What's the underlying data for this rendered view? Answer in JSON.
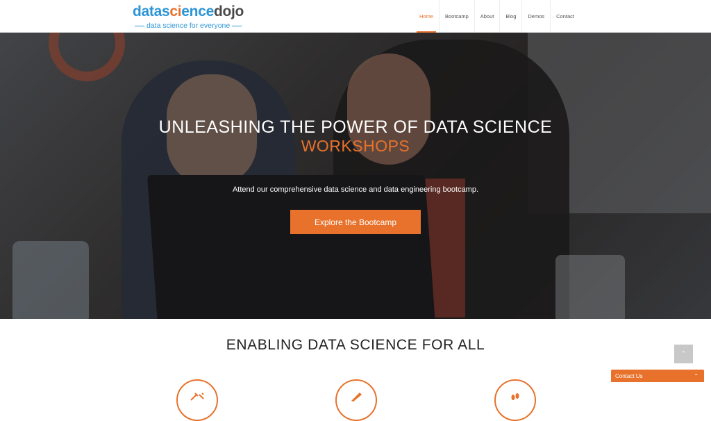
{
  "logo": {
    "part_a": "datas",
    "part_b": "ci",
    "part_c": "ence",
    "part_d": "dojo",
    "tagline": "data science for everyone"
  },
  "nav": {
    "items": [
      {
        "label": "Home",
        "active": true
      },
      {
        "label": "Bootcamp",
        "active": false
      },
      {
        "label": "About",
        "active": false
      },
      {
        "label": "Blog",
        "active": false
      },
      {
        "label": "Demos",
        "active": false
      },
      {
        "label": "Contact",
        "active": false
      }
    ]
  },
  "hero": {
    "title": "UNLEASHING THE POWER OF DATA SCIENCE",
    "subtitle": "WORKSHOPS",
    "text": "Attend our comprehensive data science and data engineering bootcamp.",
    "button_label": "Explore the Bootcamp"
  },
  "section": {
    "title": "ENABLING DATA SCIENCE FOR ALL"
  },
  "features": [
    {
      "icon": "tools-icon"
    },
    {
      "icon": "pencil-icon"
    },
    {
      "icon": "footsteps-icon"
    }
  ],
  "scroll_top": {
    "icon": "chevron-up-icon",
    "glyph": "⌃"
  },
  "contact_widget": {
    "label": "Contact Us",
    "icon": "chevron-up-icon",
    "glyph": "⌃"
  },
  "colors": {
    "accent": "#e8722c",
    "brand_blue": "#2b95d6"
  }
}
